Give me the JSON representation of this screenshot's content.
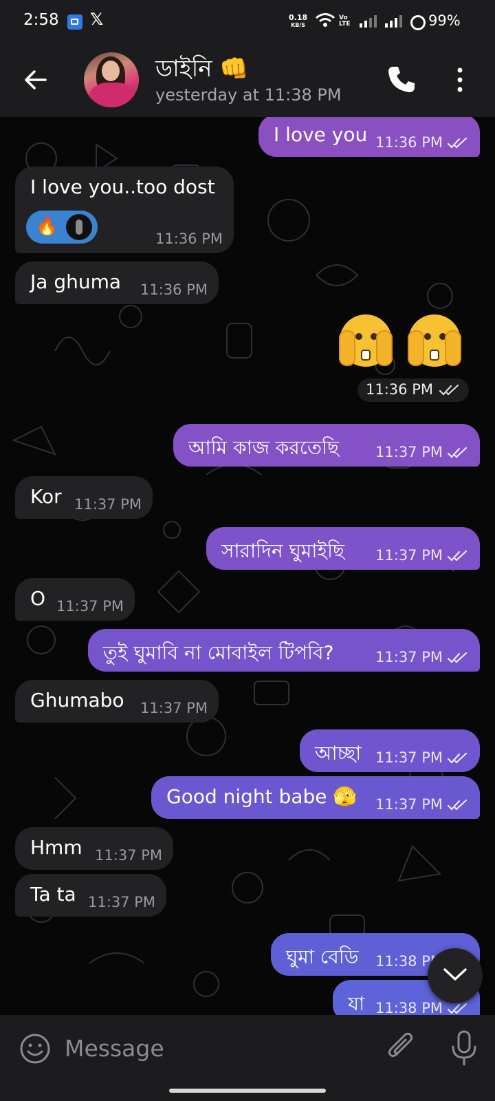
{
  "status_bar": {
    "time": "2:58",
    "net_speed_value": "0.18",
    "net_speed_unit": "KB/S",
    "volte_label": "Vo LTE",
    "battery": "99%"
  },
  "header": {
    "contact_name": "ডাইনি 👊",
    "last_seen": "yesterday at 11:38 PM"
  },
  "messages": [
    {
      "dir": "out",
      "text": "I love you",
      "time": "11:36 PM"
    },
    {
      "dir": "in",
      "text": "I love you..too dost",
      "time": "11:36 PM",
      "reaction": "🔥"
    },
    {
      "dir": "in",
      "text": "Ja ghuma",
      "time": "11:36 PM"
    },
    {
      "dir": "out",
      "text": "",
      "time": "11:36 PM",
      "emoji": "🫣🫣"
    },
    {
      "dir": "out",
      "text": "আমি কাজ করতেছি",
      "time": "11:37 PM"
    },
    {
      "dir": "in",
      "text": "Kor",
      "time": "11:37 PM"
    },
    {
      "dir": "out",
      "text": "সারাদিন ঘুমাইছি",
      "time": "11:37 PM"
    },
    {
      "dir": "in",
      "text": "O",
      "time": "11:37 PM"
    },
    {
      "dir": "out",
      "text": "তুই ঘুমাবি না মোবাইল টিপবি?",
      "time": "11:37 PM"
    },
    {
      "dir": "in",
      "text": "Ghumabo",
      "time": "11:37 PM"
    },
    {
      "dir": "out",
      "text": "আচ্ছা",
      "time": "11:37 PM"
    },
    {
      "dir": "out",
      "text": "Good night babe 🫣",
      "time": "11:37 PM"
    },
    {
      "dir": "in",
      "text": "Hmm",
      "time": "11:37 PM"
    },
    {
      "dir": "in",
      "text": "Ta ta",
      "time": "11:37 PM"
    },
    {
      "dir": "out",
      "text": "ঘুমা বেডি",
      "time": "11:38 PM"
    },
    {
      "dir": "out",
      "text": "যা",
      "time": "11:38 PM"
    }
  ],
  "input": {
    "placeholder": "Message"
  },
  "icons": {
    "back": "arrow-left-icon",
    "call": "phone-icon",
    "menu": "more-vertical-icon",
    "emoji": "smile-icon",
    "attach": "paperclip-icon",
    "mic": "microphone-icon",
    "scroll_down": "chevron-down-icon",
    "read": "double-check-icon"
  },
  "colors": {
    "header_bg": "#1c1c1e",
    "outgoing_top": "#8454c8",
    "outgoing_bottom": "#5f63d8",
    "incoming_bg": "#222224",
    "reaction_bg": "#3a83d0"
  }
}
